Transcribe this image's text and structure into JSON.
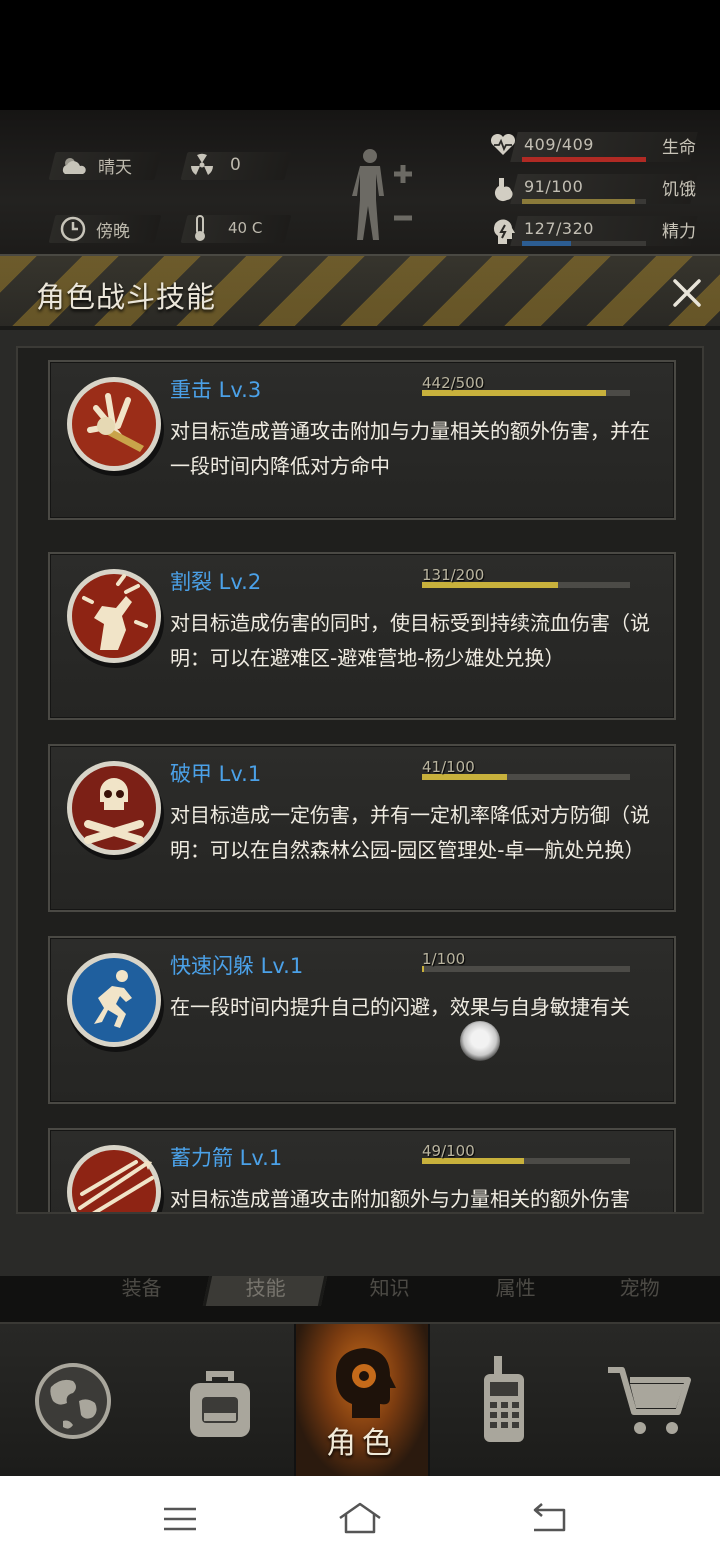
{
  "status": {
    "weather": "晴天",
    "radiation": "0",
    "time_of_day": "傍晚",
    "temperature": "40 C"
  },
  "vitals": [
    {
      "label": "生命",
      "value": "409/409",
      "fraction": 1.0,
      "color": "#b02a24",
      "icon": "heart-icon"
    },
    {
      "label": "饥饿",
      "value": "91/100",
      "fraction": 0.91,
      "color": "#8a7a3a",
      "icon": "stomach-icon"
    },
    {
      "label": "精力",
      "value": "127/320",
      "fraction": 0.397,
      "color": "#2c5d92",
      "icon": "energy-icon"
    }
  ],
  "panel": {
    "title": "角色战斗技能"
  },
  "skills": [
    {
      "name": "重击 Lv.3",
      "xp": "442/500",
      "fraction": 0.884,
      "description": "对目标造成普通攻击附加与力量相关的额外伤害，并在一段时间内降低对方命中",
      "icon": "heavy-strike-icon"
    },
    {
      "name": "割裂 Lv.2",
      "xp": "131/200",
      "fraction": 0.655,
      "description": "对目标造成伤害的同时，使目标受到持续流血伤害（说明：可以在避难区-避难营地-杨少雄处兑换）",
      "icon": "rend-icon"
    },
    {
      "name": "破甲 Lv.1",
      "xp": "41/100",
      "fraction": 0.41,
      "description": "对目标造成一定伤害，并有一定机率降低对方防御（说明：可以在自然森林公园-园区管理处-卓一航处兑换）",
      "icon": "skull-icon"
    },
    {
      "name": "快速闪躲 Lv.1",
      "xp": "1/100",
      "fraction": 0.01,
      "description": "在一段时间内提升自己的闪避，效果与自身敏捷有关",
      "icon": "dodge-icon"
    },
    {
      "name": "蓄力箭 Lv.1",
      "xp": "49/100",
      "fraction": 0.49,
      "description": "对目标造成普通攻击附加额外与力量相关的额外伤害",
      "icon": "charged-arrow-icon"
    }
  ],
  "sub_tabs": [
    "装备",
    "技能",
    "知识",
    "属性",
    "宠物"
  ],
  "nav": {
    "active_label": "角色"
  }
}
